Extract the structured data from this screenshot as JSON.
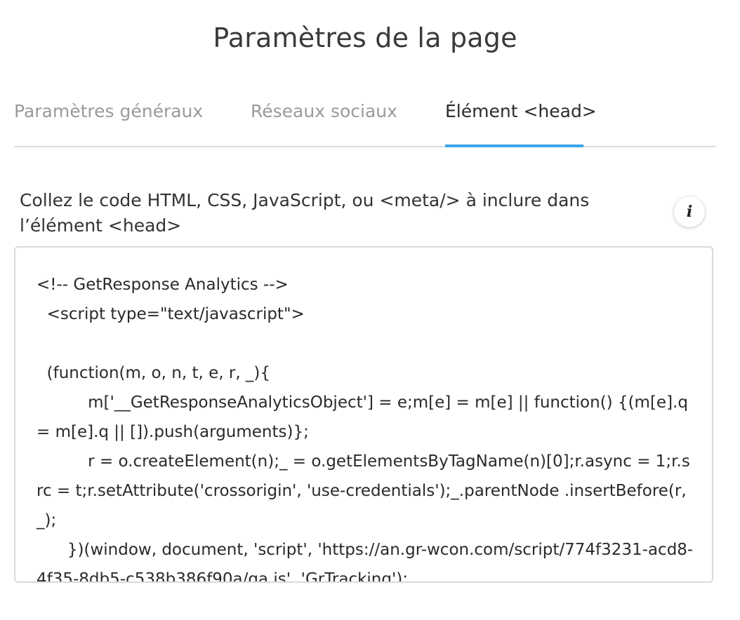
{
  "page": {
    "title": "Paramètres de la page"
  },
  "tabs": [
    {
      "label": "Paramètres généraux",
      "active": false
    },
    {
      "label": "Réseaux sociaux",
      "active": false
    },
    {
      "label": "Élément <head>",
      "active": true
    }
  ],
  "head_element": {
    "label": "Collez le code HTML, CSS, JavaScript, ou <meta/> à inclure dans l’élément <head>",
    "info_icon": "i",
    "code": "<!-- GetResponse Analytics -->\n  <script type=\"text/javascript\">\n\n  (function(m, o, n, t, e, r, _){\n          m['__GetResponseAnalyticsObject'] = e;m[e] = m[e] || function() {(m[e].q = m[e].q || []).push(arguments)};\n          r = o.createElement(n);_ = o.getElementsByTagName(n)[0];r.async = 1;r.src = t;r.setAttribute('crossorigin', 'use-credentials');_.parentNode .insertBefore(r, _);\n      })(window, document, 'script', 'https://an.gr-wcon.com/script/774f3231-acd8-4f35-8db5-c538b386f90a/ga.js', 'GrTracking');"
  },
  "colors": {
    "accent": "#3aa6ea",
    "tab_inactive": "#9a9a9a",
    "tab_active": "#2c2c2c",
    "border": "#dadada"
  }
}
